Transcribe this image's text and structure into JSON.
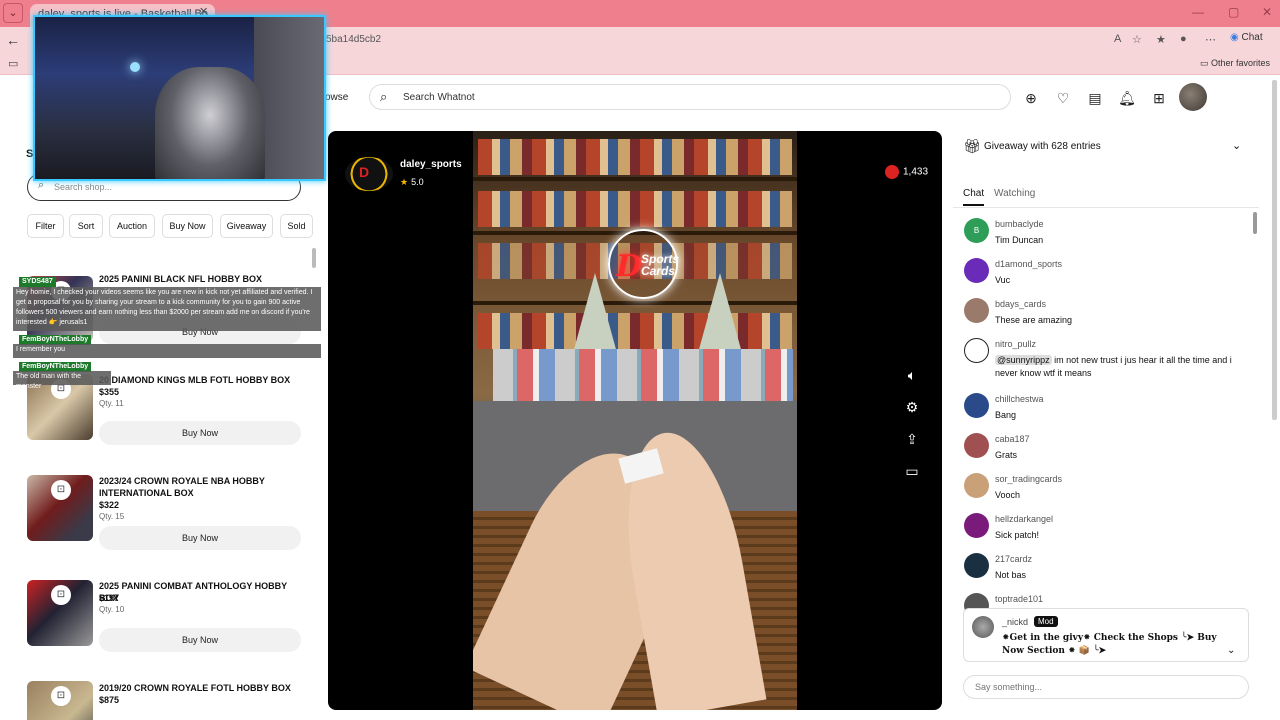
{
  "browser": {
    "tab_title": "daley_sports is live - Basketball Bo",
    "url": "5ba14d5cb2",
    "chat_label": "Chat",
    "other_favorites": "Other favorites"
  },
  "header": {
    "browse_label": "owse",
    "search_placeholder": "Search Whatnot"
  },
  "shop": {
    "heading": "S",
    "search_placeholder": "Search shop...",
    "filters": [
      "Filter",
      "Sort",
      "Auction",
      "Buy Now",
      "Giveaway",
      "Sold"
    ],
    "items": [
      {
        "title": "2025 PANINI BLACK NFL HOBBY BOX",
        "price": "",
        "qty": "",
        "button": "Buy Now"
      },
      {
        "title": "20 DIAMOND KINGS MLB FOTL HOBBY BOX",
        "price": "$355",
        "qty": "Qty. 11",
        "button": "Buy Now"
      },
      {
        "title": "2023/24 CROWN ROYALE NBA HOBBY INTERNATIONAL BOX",
        "price": "$322",
        "qty": "Qty. 15",
        "button": "Buy Now"
      },
      {
        "title": "2025 PANINI COMBAT ANTHOLOGY HOBBY BOX",
        "price": "$197",
        "qty": "Qty. 10",
        "button": "Buy Now"
      },
      {
        "title": "2019/20 CROWN ROYALE FOTL HOBBY BOX",
        "price": "$875",
        "qty": "",
        "button": "Buy Now"
      }
    ]
  },
  "overlay_chat": [
    {
      "name": "SYDS487",
      "text": "Hey homie, I checked your videos seems like you are new in kick not yet affiliated and verified. I get a proposal for you by sharing your stream to a kick community for you to gain 900 active followers 500 viewers and earn nothing less than $2000 per stream add me on discord if you're interested 👉 jerusals1"
    },
    {
      "name": "FemBoyNTheLobby",
      "text": "I remember you"
    },
    {
      "name": "FemBoyNTheLobby",
      "text": "The old man with the monster"
    }
  ],
  "stream": {
    "streamer": "daley_sports",
    "rating": "5.0",
    "viewers": "1,433",
    "neon_letter": "D",
    "neon_text_1": "Sports",
    "neon_text_2": "Cards",
    "logo_letter": "D"
  },
  "sidepanel": {
    "giveaway": "Giveaway with 628 entries",
    "tabs": [
      "Chat",
      "Watching"
    ],
    "messages": [
      {
        "user": "bumbaclyde",
        "text": "Tim Duncan",
        "avatar": "B",
        "color": "#2e9d58"
      },
      {
        "user": "d1amond_sports",
        "text": "Vuc",
        "avatar": "",
        "color": "#6a2bb8"
      },
      {
        "user": "bdays_cards",
        "text": "These are amazing",
        "avatar": "",
        "color": "#9a7a6a"
      },
      {
        "user": "nitro_pullz",
        "mention": "@sunnyrippz",
        "text": " im not new trust i jus hear it all the time and i never know wtf it means",
        "avatar": "",
        "color": "#ffffff"
      },
      {
        "user": "chillchestwa",
        "text": "Bang",
        "avatar": "",
        "color": "#2a4a8a"
      },
      {
        "user": "caba187",
        "text": "Grats",
        "avatar": "",
        "color": "#a05050"
      },
      {
        "user": "sor_tradingcards",
        "text": "Vooch",
        "avatar": "",
        "color": "#c9a078"
      },
      {
        "user": "hellzdarkangel",
        "text": "Sick patch!",
        "avatar": "",
        "color": "#7a1a7a"
      },
      {
        "user": "217cardz",
        "text": "Not bas",
        "avatar": "",
        "color": "#1a3040"
      },
      {
        "user": "toptrade101",
        "text": "",
        "avatar": "",
        "color": "#555555"
      }
    ],
    "pinned": {
      "user": "_nickd",
      "badge": "Mod",
      "text": "⁕Get in the givy⁕ Check the Shops ╰➤ Buy Now Section ⁕ 📦 ╰➤"
    },
    "input_placeholder": "Say something..."
  }
}
